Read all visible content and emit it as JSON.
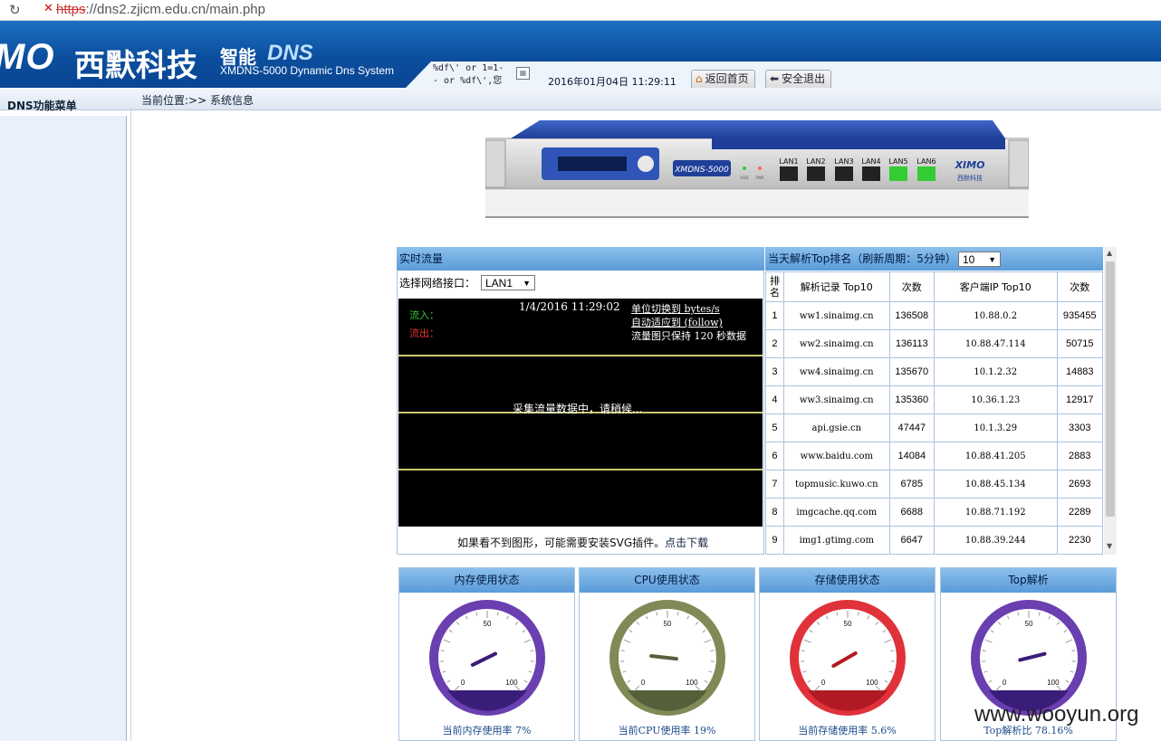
{
  "browser": {
    "url_scheme": "https",
    "url_rest": "://dns2.zjicm.edu.cn/main.php"
  },
  "header": {
    "logo_mark": "MO",
    "logo_cn": "西默科技",
    "logo_smart": "智能",
    "logo_dns": "DNS",
    "logo_sub": "XMDNS-5000 Dynamic Dns System",
    "injected_user_line1": "%df\\'  or 1=1-",
    "injected_user_line2": "- or %df\\',您",
    "datetime": "2016年01月04日  11:29:11",
    "home_btn": "返回首页",
    "logout_btn": "安全退出",
    "colors": {
      "header_bg": "#0b4e9e",
      "accent": "#5a9bd8"
    }
  },
  "sidebar": {
    "title": "DNS功能菜单"
  },
  "breadcrumb": "当前位置:>> 系统信息",
  "device": {
    "model": "XMDNS-5000",
    "ports": [
      "LAN1",
      "LAN2",
      "LAN3",
      "LAN4",
      "LAN5",
      "LAN6"
    ],
    "brand": "XIMO",
    "brand_cn": "西默科技",
    "led_labels": [
      "HDD",
      "PWR"
    ]
  },
  "traffic": {
    "title": "实时流量",
    "select_label": "选择网络接口：",
    "selected_interface": "LAN1",
    "in_label": "流入：",
    "out_label": "流出：",
    "timestamp": "1/4/2016 11:29:02",
    "unit_switch": "单位切换到 bytes/s",
    "auto_fit": "自动适应到 (follow)",
    "keep_note": "流量图只保持 120 秒数据",
    "collecting": "采集流量数据中，请稍候...",
    "footer_text": "如果看不到图形，可能需要安装SVG插件。",
    "footer_link": "点击下载"
  },
  "top_ranking": {
    "title": "当天解析Top排名（刷新周期：5分钟）",
    "selected_count": "10",
    "headers": [
      "排名",
      "解析记录 Top10",
      "次数",
      "客户端IP Top10",
      "次数"
    ],
    "rows": [
      [
        "1",
        "ww1.sinaimg.cn",
        "136508",
        "10.88.0.2",
        "935455"
      ],
      [
        "2",
        "ww2.sinaimg.cn",
        "136113",
        "10.88.47.114",
        "50715"
      ],
      [
        "3",
        "ww4.sinaimg.cn",
        "135670",
        "10.1.2.32",
        "14883"
      ],
      [
        "4",
        "ww3.sinaimg.cn",
        "135360",
        "10.36.1.23",
        "12917"
      ],
      [
        "5",
        "api.gsie.cn",
        "47447",
        "10.1.3.29",
        "3303"
      ],
      [
        "6",
        "www.baidu.com",
        "14084",
        "10.88.41.205",
        "2883"
      ],
      [
        "7",
        "topmusic.kuwo.cn",
        "6785",
        "10.88.45.134",
        "2693"
      ],
      [
        "8",
        "imgcache.qq.com",
        "6688",
        "10.88.71.192",
        "2289"
      ],
      [
        "9",
        "img1.gtimg.com",
        "6647",
        "10.88.39.244",
        "2230"
      ]
    ]
  },
  "gauges": [
    {
      "title": "内存使用状态",
      "footer": "当前内存使用率 7%",
      "value": 7,
      "color": "#6a3fb0",
      "dark": "#3a1d78"
    },
    {
      "title": "CPU使用状态",
      "footer": "当前CPU使用率 19%",
      "value": 19,
      "color": "#7f8a56",
      "dark": "#55603a"
    },
    {
      "title": "存储使用状态",
      "footer": "当前存储使用率 5.6%",
      "value": 5.6,
      "color": "#e0323a",
      "dark": "#b11a22"
    },
    {
      "title": "Top解析",
      "footer": "Top解析比 78.16%",
      "value": 78.16,
      "color": "#6a3fb0",
      "dark": "#3a1d78"
    }
  ],
  "gauge_ticks": [
    "0",
    "50",
    "100"
  ],
  "watermark": "www.wooyun.org"
}
